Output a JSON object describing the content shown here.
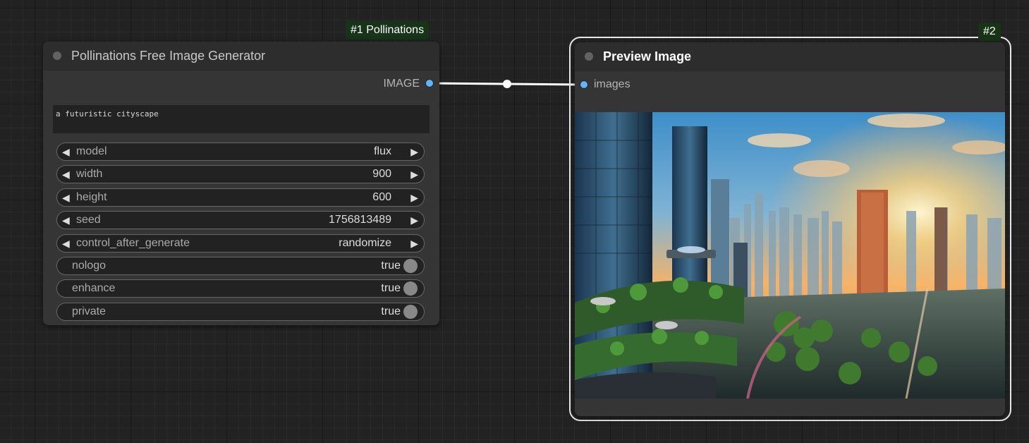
{
  "nodes": {
    "generator": {
      "badge": "#1 Pollinations",
      "title": "Pollinations Free Image Generator",
      "output_label": "IMAGE",
      "prompt": "a futuristic cityscape",
      "widgets": [
        {
          "name": "model",
          "value": "flux",
          "kind": "combo"
        },
        {
          "name": "width",
          "value": "900",
          "kind": "number"
        },
        {
          "name": "height",
          "value": "600",
          "kind": "number"
        },
        {
          "name": "seed",
          "value": "1756813489",
          "kind": "number"
        },
        {
          "name": "control_after_generate",
          "value": "randomize",
          "kind": "combo"
        },
        {
          "name": "nologo",
          "value": "true",
          "kind": "toggle"
        },
        {
          "name": "enhance",
          "value": "true",
          "kind": "toggle"
        },
        {
          "name": "private",
          "value": "true",
          "kind": "toggle"
        }
      ]
    },
    "preview": {
      "badge": "#2",
      "title": "Preview Image",
      "input_label": "images"
    }
  },
  "colors": {
    "canvas": "#222222",
    "node_body": "#353535",
    "node_title": "#2d2d2d",
    "badge_bg": "#173318",
    "slot_image": "#64b5f6",
    "link": "#ffffff",
    "selection": "#e8e8e8"
  },
  "icons": {
    "decrement": "triangle-left",
    "increment": "triangle-right",
    "toggle": "circle-knob"
  }
}
